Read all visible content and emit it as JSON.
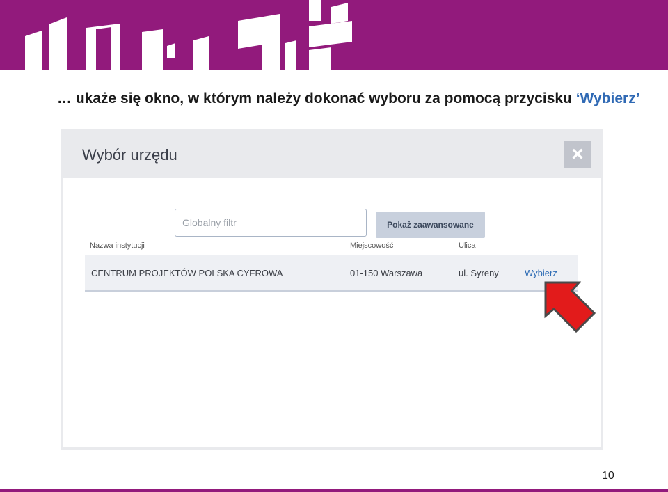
{
  "slide": {
    "title_prefix": "… ukaże się okno, w którym należy dokonać wyboru za pomocą przycisku ",
    "title_highlight": "‘Wybierz’",
    "page_number": "10",
    "colors": {
      "banner": "#921a7c",
      "highlight": "#2f69b4",
      "arrow": "#e21b1b"
    }
  },
  "modal": {
    "title": "Wybór urzędu",
    "close_label": "×",
    "filter_placeholder": "Globalny filtr",
    "advanced_button": "Pokaż zaawansowane",
    "columns": [
      "Nazwa instytucji",
      "Miejscowość",
      "Ulica"
    ],
    "rows": [
      {
        "name": "CENTRUM PROJEKTÓW POLSKA CYFROWA",
        "city": "01-150 Warszawa",
        "street": "ul. Syreny",
        "action": "Wybierz"
      }
    ]
  }
}
